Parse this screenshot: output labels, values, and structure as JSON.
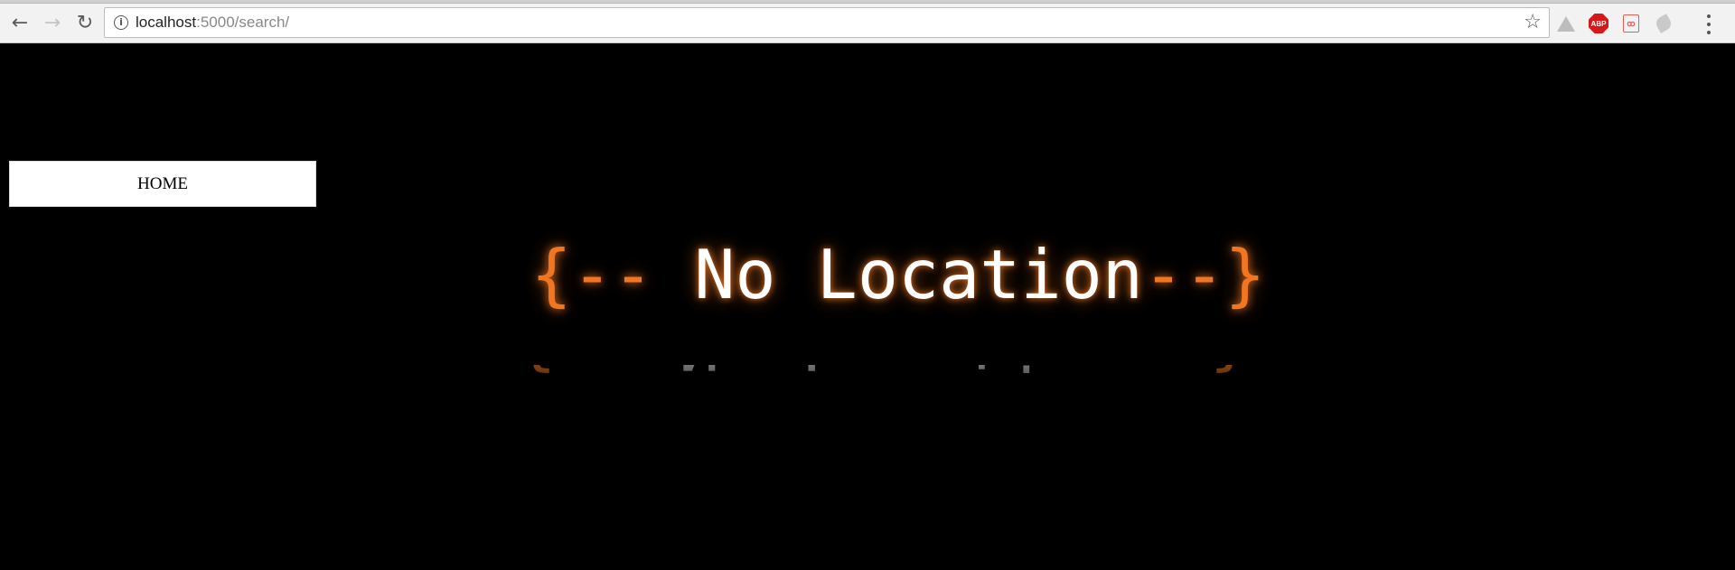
{
  "browser": {
    "url_host": "localhost",
    "url_path": ":5000/search/",
    "extensions": [
      "drive-icon",
      "adblock-plus-icon",
      "pdf-icon",
      "leaf-icon"
    ],
    "abp_label": "ABP",
    "pdf_label": "ꝏ"
  },
  "page": {
    "home_label": "HOME",
    "headline": {
      "open_brace": "{--",
      "text": " No Location",
      "close_brace": "--}"
    }
  },
  "colors": {
    "background": "#000000",
    "accent": "#f07622",
    "button_bg": "#ffffff"
  }
}
